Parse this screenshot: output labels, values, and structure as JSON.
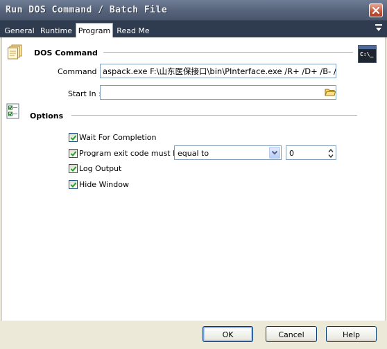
{
  "window": {
    "title": "Run DOS Command / Batch File"
  },
  "tabs": [
    {
      "label": "General",
      "active": false
    },
    {
      "label": "Runtime",
      "active": false
    },
    {
      "label": "Program",
      "active": true
    },
    {
      "label": "Read Me",
      "active": false
    }
  ],
  "dos_command": {
    "section_title": "DOS Command",
    "command_label": "Command :",
    "command_value": "aspack.exe F:\\山东医保接口\\bin\\PInterface.exe /R+ /D+ /B- /S",
    "start_in_label": "Start In :",
    "start_in_value": "",
    "console_icon_text": "C:\\_"
  },
  "options": {
    "section_title": "Options",
    "wait_for_completion": {
      "label": "Wait For Completion",
      "checked": true
    },
    "exit_code": {
      "label": "Program exit code must be",
      "checked": true,
      "comparison": "equal to",
      "value": "0"
    },
    "log_output": {
      "label": "Log Output",
      "checked": true
    },
    "hide_window": {
      "label": "Hide Window",
      "checked": true
    }
  },
  "buttons": {
    "ok": "OK",
    "cancel": "Cancel",
    "help": "Help"
  }
}
